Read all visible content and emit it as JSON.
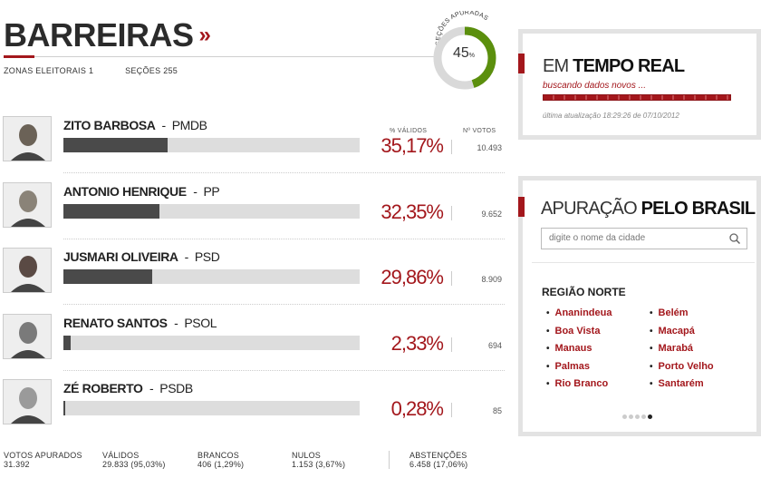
{
  "header": {
    "city": "BARREIRAS",
    "arrow": "»",
    "zonas": "ZONAS ELEITORAIS 1",
    "secoes": "SEÇÕES 255"
  },
  "gauge": {
    "label": "SEÇÕES APURADAS",
    "value": "45",
    "unit": "%",
    "fraction": 0.45,
    "color": "#5b8f0d"
  },
  "columns": {
    "pct": "% VÁLIDOS",
    "votes": "Nº VOTOS"
  },
  "candidates": [
    {
      "name": "ZITO BARBOSA",
      "sep": "-",
      "party": "PMDB",
      "pct": "35,17%",
      "share": 0.3517,
      "votes": "10.493"
    },
    {
      "name": "ANTONIO HENRIQUE",
      "sep": "-",
      "party": "PP",
      "pct": "32,35%",
      "share": 0.3235,
      "votes": "9.652"
    },
    {
      "name": "JUSMARI OLIVEIRA",
      "sep": "-",
      "party": "PSD",
      "pct": "29,86%",
      "share": 0.2986,
      "votes": "8.909"
    },
    {
      "name": "RENATO SANTOS",
      "sep": "-",
      "party": "PSOL",
      "pct": "2,33%",
      "share": 0.0233,
      "votes": "694"
    },
    {
      "name": "ZÉ ROBERTO",
      "sep": "-",
      "party": "PSDB",
      "pct": "0,28%",
      "share": 0.0028,
      "votes": "85"
    }
  ],
  "totals": {
    "apurados_label": "VOTOS APURADOS",
    "apurados": "31.392",
    "validos_label": "VÁLIDOS",
    "validos": "29.833 (95,03%)",
    "brancos_label": "BRANCOS",
    "brancos": "406 (1,29%)",
    "nulos_label": "NULOS",
    "nulos": "1.153 (3,67%)",
    "abstencoes_label": "ABSTENÇÕES",
    "abstencoes": "6.458 (17,06%)"
  },
  "realtime": {
    "title_light": "EM ",
    "title_bold": "TEMPO REAL",
    "status": "buscando dados novos ...",
    "updated": "última atualização 18:29:26 de 07/10/2012"
  },
  "brasil": {
    "title_light": "APURAÇÃO ",
    "title_bold": "PELO BRASIL",
    "search_placeholder": "digite o nome da cidade",
    "region": "REGIÃO NORTE",
    "cities_left": [
      "Ananindeua",
      "Boa Vista",
      "Manaus",
      "Palmas",
      "Rio Branco"
    ],
    "cities_right": [
      "Belém",
      "Macapá",
      "Marabá",
      "Porto Velho",
      "Santarém"
    ],
    "pages": 5,
    "active_page": 5
  },
  "colors": {
    "accent": "#a3171c",
    "bar_fill": "#4a4a4a",
    "bar_bg": "#dddddd",
    "gauge_green": "#5b8f0d"
  }
}
